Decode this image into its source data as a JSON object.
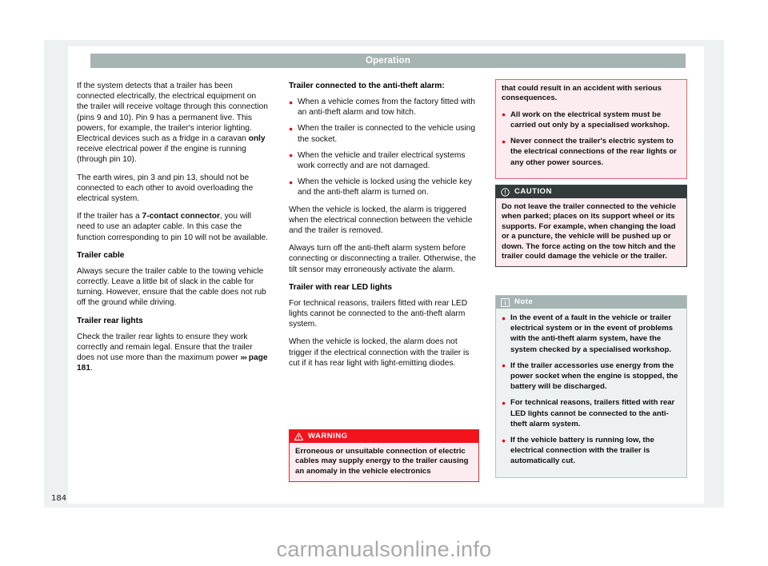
{
  "header": {
    "title": "Operation"
  },
  "folio": {
    "page_number": "184"
  },
  "watermark": {
    "text": "carmanualsonline.info"
  },
  "colors": {
    "header_bar": "#a6b4b4",
    "warning_red": "#f4131b",
    "warning_bg": "#fdecef",
    "caution_dark": "#333b3d",
    "note_gray": "#a6b4b4",
    "note_bg": "#eef1f1",
    "bullet_red": "#e2001a",
    "page_mat": "#eef1f2"
  },
  "left_column": {
    "p1_a": "If the system detects that a trailer has been connected electrically, the electrical equipment on the trailer will receive voltage through this connection (pins 9 and 10). Pin 9 has a permanent live. This powers, for example, the trailer's interior lighting. Electrical devices such as a fridge in a caravan ",
    "p1_bold": "only",
    "p1_b": " receive electrical power if the engine is running (through pin 10).",
    "p2": "The earth wires, pin 3 and pin 13, should not be connected to each other to avoid overloading the electrical system.",
    "p3_a": "If the trailer has a ",
    "p3_bold": "7-contact connector",
    "p3_b": ", you will need to use an adapter cable. In this case the function corresponding to pin 10 will not be available.",
    "subhead_cable": "Trailer cable",
    "p4": "Always secure the trailer cable to the towing vehicle correctly. Leave a little bit of slack in the cable for turning. However, ensure that the cable does not rub off the ground while driving.",
    "subhead_rear_lights": "Trailer rear lights",
    "p5_a": "Check the trailer rear lights to ensure they work correctly and remain legal. Ensure that the trailer does not use more than the maximum power ",
    "p5_arrow": "›››",
    "p5_ref": " page 181",
    "p5_b": "."
  },
  "middle_column": {
    "subhead_alarm": "Trailer connected to the anti-theft alarm:",
    "bullets": [
      "When a vehicle comes from the factory fitted with an anti-theft alarm and tow hitch.",
      "When the trailer is connected to the vehicle using the socket.",
      "When the vehicle and trailer electrical systems work correctly and are not damaged.",
      "When the vehicle is locked using the vehicle key and the anti-theft alarm is turned on."
    ],
    "p1": "When the vehicle is locked, the alarm is triggered when the electrical connection between the vehicle and the trailer is removed.",
    "p2": "Always turn off the anti-theft alarm system before connecting or disconnecting a trailer. Otherwise, the tilt sensor may erroneously activate the alarm.",
    "subhead_led": "Trailer with rear LED lights",
    "p3": "For technical reasons, trailers fitted with rear LED lights cannot be connected to the anti-theft alarm system.",
    "p4": "When the vehicle is locked, the alarm does not trigger if the electrical connection with the trailer is cut if it has rear light with light-emitting diodes.",
    "warning": {
      "label": "WARNING",
      "icon": "warning-triangle-icon",
      "text": "Erroneous or unsuitable connection of electric cables may supply energy to the trailer causing an anomaly in the vehicle electronics"
    }
  },
  "right_column": {
    "warning_continued": {
      "text": "that could result in an accident with serious consequences.",
      "bullets": [
        "All work on the electrical system must be carried out only by a specialised workshop.",
        "Never connect the trailer's electric system to the electrical connections of the rear lights or any other power sources."
      ]
    },
    "caution": {
      "label": "CAUTION",
      "icon": "exclamation-circle-icon",
      "text": "Do not leave the trailer connected to the vehicle when parked; places on its support wheel or its supports. For example, when changing the load or a puncture, the vehicle will be pushed up or down. The force acting on the tow hitch and the trailer could damage the vehicle or the trailer."
    },
    "note": {
      "label": "Note",
      "icon": "info-square-icon",
      "bullets": [
        "In the event of a fault in the vehicle or trailer electrical system or in the event of problems with the anti-theft alarm system, have the system checked by a specialised workshop.",
        "If the trailer accessories use energy from the power socket when the engine is stopped, the battery will be discharged.",
        "For technical reasons, trailers fitted with rear LED lights cannot be connected to the anti-theft alarm system.",
        "If the vehicle battery is running low, the electrical connection with the trailer is automatically cut."
      ]
    }
  }
}
